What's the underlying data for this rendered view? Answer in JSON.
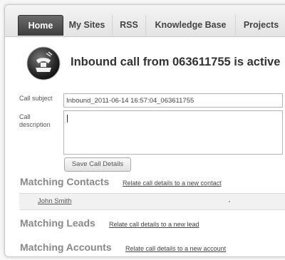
{
  "tabs": [
    {
      "label": "Home",
      "active": true
    },
    {
      "label": "My Sites",
      "active": false
    },
    {
      "label": "RSS",
      "active": false
    },
    {
      "label": "Knowledge Base",
      "active": false
    },
    {
      "label": "Projects",
      "active": false
    }
  ],
  "call": {
    "icon": "phone-icon",
    "headline": "Inbound call from 063611755 is active"
  },
  "form": {
    "subject_label": "Call subject",
    "subject_value": "Inbound_2011-06-14 16:57:04_063611755",
    "description_label": "Call description",
    "description_value": "",
    "save_label": "Save Call Details"
  },
  "contacts": {
    "title": "Matching Contacts",
    "relate_link": "Relate call details to a new contact",
    "items": [
      {
        "name": "John Smith"
      }
    ]
  },
  "leads": {
    "title": "Matching Leads",
    "relate_link": "Relate call details to a new lead"
  },
  "accounts": {
    "title": "Matching Accounts",
    "relate_link": "Relate call details to a new account"
  },
  "colors": {
    "active_tab": "#4a4a4a",
    "section_title": "#888888",
    "headline": "#333333"
  }
}
